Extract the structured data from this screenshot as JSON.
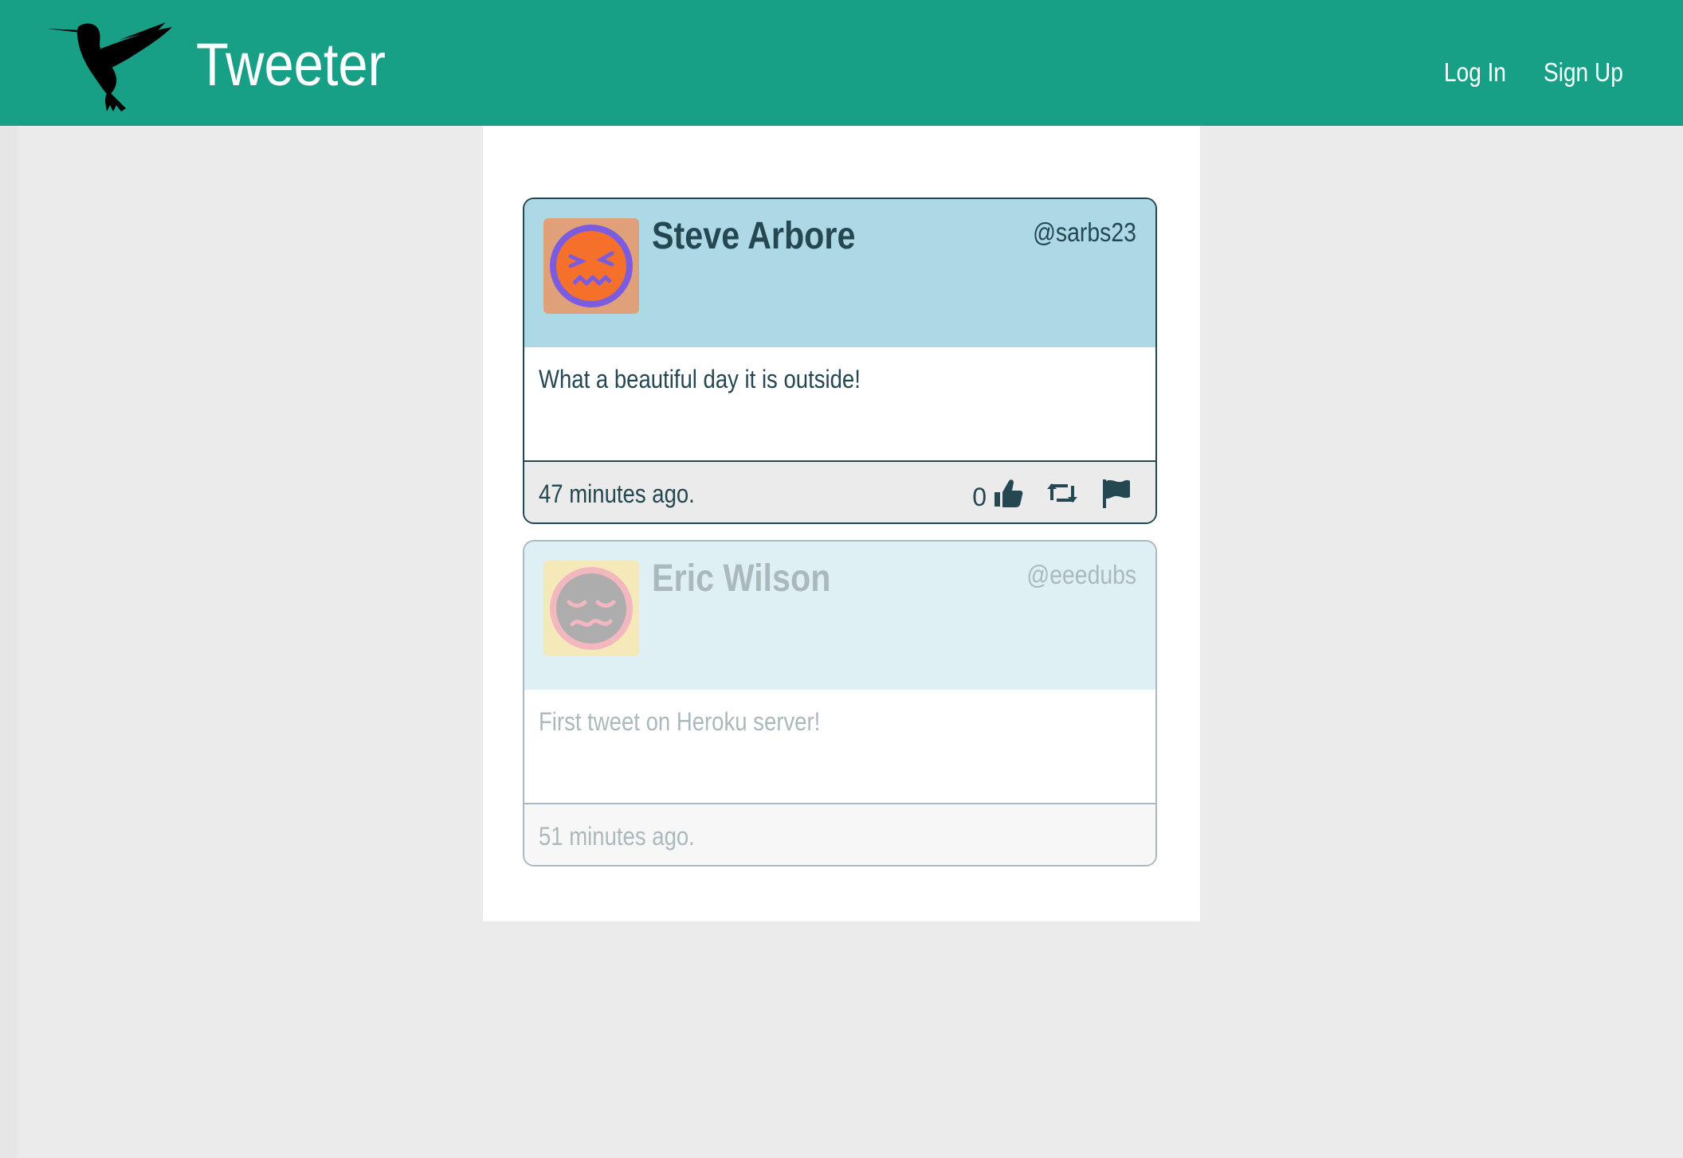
{
  "navbar": {
    "brand": "Tweeter",
    "logo_icon": "hummingbird-icon",
    "links": [
      {
        "label": "Log In"
      },
      {
        "label": "Sign Up"
      }
    ]
  },
  "colors": {
    "navbar": "#18a087",
    "tweet_header": "#add8e6",
    "text": "#244751",
    "page_background": "#ebebeb"
  },
  "tweets": [
    {
      "name": "Steve Arbore",
      "handle": "@sarbs23",
      "text": "What a beautiful day it is outside!",
      "time": "47 minutes ago.",
      "likes": "0",
      "avatar_icon": "angry-face-icon",
      "actions": [
        "like-icon",
        "retweet-icon",
        "flag-icon"
      ]
    },
    {
      "name": "Eric Wilson",
      "handle": "@eeedubs",
      "text": "First tweet on Heroku server!",
      "time": "51 minutes ago.",
      "avatar_icon": "sleepy-face-icon"
    }
  ]
}
